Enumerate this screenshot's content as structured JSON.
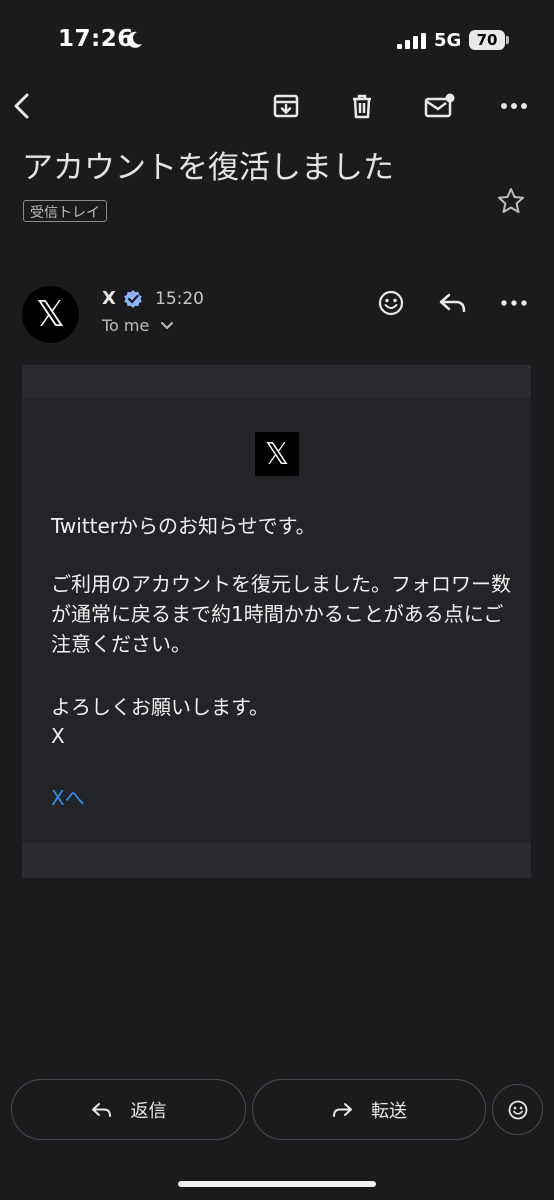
{
  "status_bar": {
    "time": "17:26",
    "network": "5G",
    "battery": "70",
    "icons": [
      "moon-icon",
      "signal-icon",
      "battery-icon"
    ]
  },
  "toolbar": {
    "icons": [
      "back-icon",
      "archive-icon",
      "delete-icon",
      "mark-unread-icon",
      "more-icon"
    ]
  },
  "email": {
    "subject": "アカウントを復活しました",
    "label": "受信トレイ",
    "sender": {
      "name": "X",
      "time": "15:20",
      "to": "To me",
      "avatar_glyph": "𝕏"
    },
    "body": {
      "logo_glyph": "𝕏",
      "p1": "Twitterからのお知らせです。",
      "p2": "ご利用のアカウントを復元しました。フォロワー数が通常に戻るまで約1時間かかることがある点にご注意ください。",
      "p3": "よろしくお願いします。",
      "p4": "X",
      "link": "Xへ"
    }
  },
  "actions": {
    "reply": "返信",
    "forward": "転送"
  },
  "colors": {
    "background": "#1b1b1e",
    "card": "#232427",
    "link": "#2f8be5",
    "verified": "#8ab4f8"
  }
}
